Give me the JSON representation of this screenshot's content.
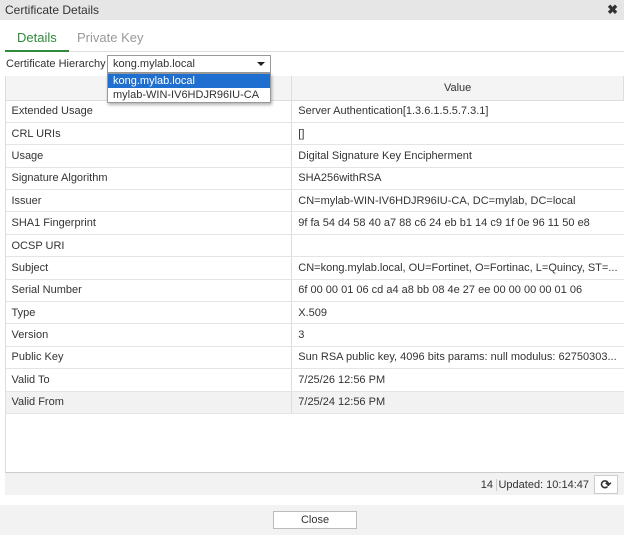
{
  "window": {
    "title": "Certificate Details",
    "close_glyph": "✖"
  },
  "tabs": [
    {
      "label": "Details"
    },
    {
      "label": "Private Key"
    }
  ],
  "hierarchy": {
    "label": "Certificate Hierarchy",
    "selected": "kong.mylab.local",
    "options": [
      "kong.mylab.local",
      "mylab-WIN-IV6HDJR96IU-CA"
    ]
  },
  "table": {
    "headers": [
      "",
      "Value"
    ],
    "rows": [
      {
        "name": "Extended Usage",
        "value": "Server Authentication[1.3.6.1.5.5.7.3.1]"
      },
      {
        "name": "CRL URIs",
        "value": "[]"
      },
      {
        "name": "Usage",
        "value": "Digital Signature Key Encipherment"
      },
      {
        "name": "Signature Algorithm",
        "value": "SHA256withRSA"
      },
      {
        "name": "Issuer",
        "value": "CN=mylab-WIN-IV6HDJR96IU-CA, DC=mylab, DC=local"
      },
      {
        "name": "SHA1 Fingerprint",
        "value": "9f fa 54 d4 58 40 a7 88 c6 24 eb b1 14 c9 1f 0e 96 11 50 e8"
      },
      {
        "name": "OCSP URI",
        "value": ""
      },
      {
        "name": "Subject",
        "value": "CN=kong.mylab.local, OU=Fortinet, O=Fortinac, L=Quincy, ST=..."
      },
      {
        "name": "Serial Number",
        "value": "6f 00 00 01 06 cd a4 a8 bb 08 4e 27 ee 00 00 00 00 01 06"
      },
      {
        "name": "Type",
        "value": "X.509"
      },
      {
        "name": "Version",
        "value": "3"
      },
      {
        "name": "Public Key",
        "value": "Sun RSA public key, 4096 bits params: null modulus: 62750303..."
      },
      {
        "name": "Valid To",
        "value": "7/25/26 12:56 PM"
      },
      {
        "name": "Valid From",
        "value": "7/25/24 12:56 PM"
      }
    ]
  },
  "status": {
    "count": "14",
    "updated": "Updated: 10:14:47",
    "refresh_glyph": "⟳"
  },
  "footer": {
    "close_label": "Close"
  }
}
